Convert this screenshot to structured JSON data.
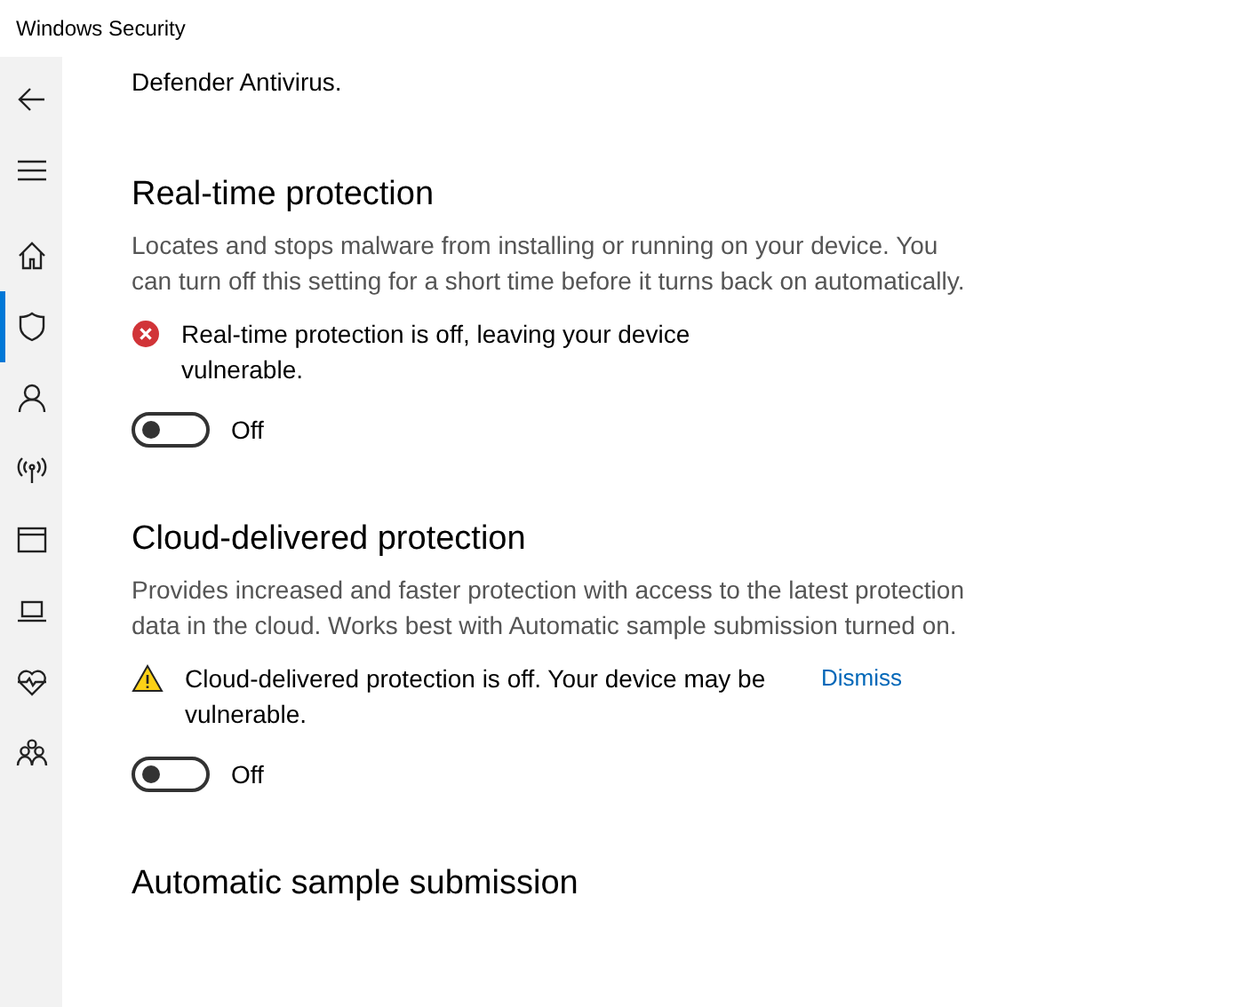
{
  "window": {
    "title": "Windows Security"
  },
  "nav": [
    {
      "selected": false
    },
    {
      "selected": false
    },
    {
      "selected": false
    },
    {
      "selected": true
    },
    {
      "selected": false
    },
    {
      "selected": false
    },
    {
      "selected": false
    },
    {
      "selected": false
    },
    {
      "selected": false
    },
    {
      "selected": false
    }
  ],
  "intro": "Defender Antivirus.",
  "sections": [
    {
      "title": "Real-time protection",
      "description": "Locates and stops malware from installing or running on your device. You can turn off this setting for a short time before it turns back on automatically.",
      "alert": {
        "kind": "error",
        "text": "Real-time protection is off, leaving your device vulnerable."
      },
      "toggle": {
        "on": false,
        "label": "Off"
      }
    },
    {
      "title": "Cloud-delivered protection",
      "description": "Provides increased and faster protection with access to the latest protection data in the cloud. Works best with Automatic sample submission turned on.",
      "alert": {
        "kind": "warning",
        "text": "Cloud-delivered protection is off. Your device may be vulnerable.",
        "action": "Dismiss"
      },
      "toggle": {
        "on": false,
        "label": "Off"
      }
    },
    {
      "title": "Automatic sample submission"
    }
  ]
}
